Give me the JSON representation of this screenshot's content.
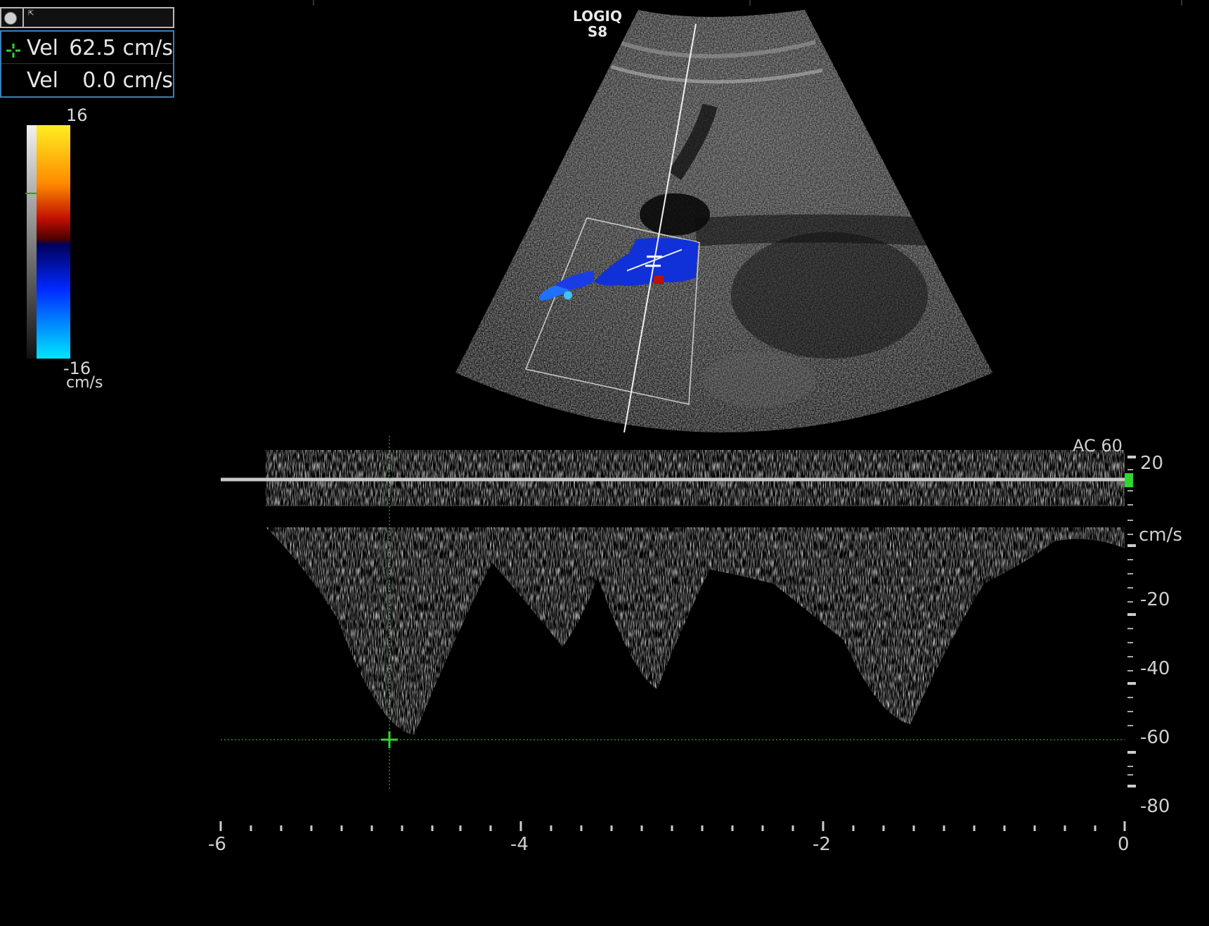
{
  "measurement_panel": {
    "rows": [
      {
        "label": "Vel",
        "value": "62.5 cm/s"
      },
      {
        "label": "Vel",
        "value": "0.0 cm/s"
      }
    ]
  },
  "color_scale": {
    "max_label": "16",
    "min_label": "-16",
    "unit": "cm/s"
  },
  "logo": {
    "line1": "LOGIQ",
    "line2": "S8"
  },
  "doppler": {
    "scale_label": "AC 60",
    "unit": "cm/s",
    "y_ticks": [
      "20",
      "-20",
      "-40",
      "-60",
      "-80"
    ],
    "x_ticks": [
      "-6",
      "-4",
      "-2",
      "0"
    ],
    "cursor_velocity": -62.5
  },
  "colors": {
    "panel_border": "#3e7fb8",
    "cursor": "#2fd82f",
    "baseline": "#c8c8c8"
  }
}
